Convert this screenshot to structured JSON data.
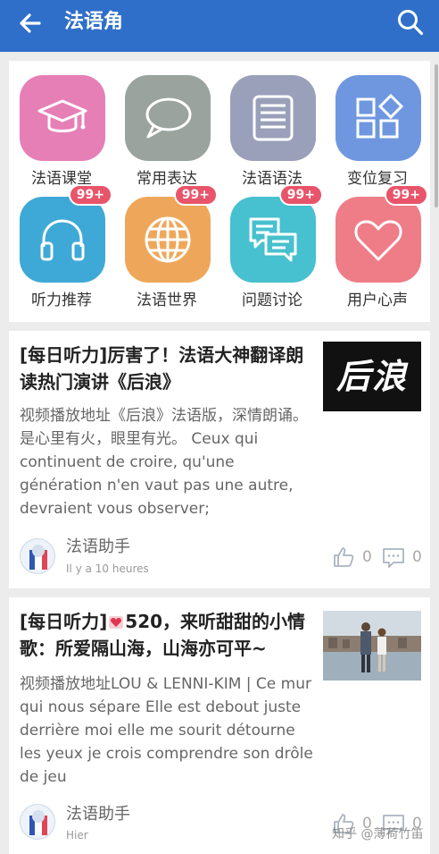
{
  "header": {
    "title": "法语角",
    "back_icon": "arrow-left-icon",
    "search_icon": "search-icon",
    "bg_color": "#2f6fc9"
  },
  "categories": [
    {
      "label": "法语课堂",
      "icon": "graduation-cap-icon",
      "color": "#e67fb6",
      "badge": ""
    },
    {
      "label": "常用表达",
      "icon": "speech-bubble-icon",
      "color": "#9aa39e",
      "badge": ""
    },
    {
      "label": "法语语法",
      "icon": "book-icon",
      "color": "#9aa0b9",
      "badge": ""
    },
    {
      "label": "变位复习",
      "icon": "shapes-icon",
      "color": "#6f97e0",
      "badge": ""
    },
    {
      "label": "听力推荐",
      "icon": "headphones-icon",
      "color": "#3ea9d6",
      "badge": "99+"
    },
    {
      "label": "法语世界",
      "icon": "globe-icon",
      "color": "#eea75a",
      "badge": "99+"
    },
    {
      "label": "问题讨论",
      "icon": "discussion-icon",
      "color": "#47c0cf",
      "badge": "99+"
    },
    {
      "label": "用户心声",
      "icon": "heart-icon",
      "color": "#ee7d88",
      "badge": "99+"
    }
  ],
  "posts": [
    {
      "title": "[每日听力]厉害了！法语大神翻译朗读热门演讲《后浪》",
      "thumb_text": "后浪",
      "excerpt": "视频播放地址《后浪》法语版，深情朗诵。是心里有火，眼里有光。 Ceux qui continuent de croire, qu'une génération n'en vaut pas une autre, devraient vous observer;",
      "author": "法语助手",
      "time": "Il y a 10 heures",
      "likes": "0",
      "comments": "0"
    },
    {
      "title_prefix": "[每日听力]",
      "title_suffix": "520，来听甜甜的小情歌：所爱隔山海，山海亦可平~",
      "excerpt": "视频播放地址LOU & LENNI-KIM | Ce mur qui nous sépare Elle est debout juste derrière moi elle me sourit détourne les yeux je crois comprendre son drôle de jeu",
      "author": "法语助手",
      "time": "Hier",
      "likes": "0",
      "comments": "0"
    }
  ],
  "watermark": "知乎 @薄荷竹笛"
}
